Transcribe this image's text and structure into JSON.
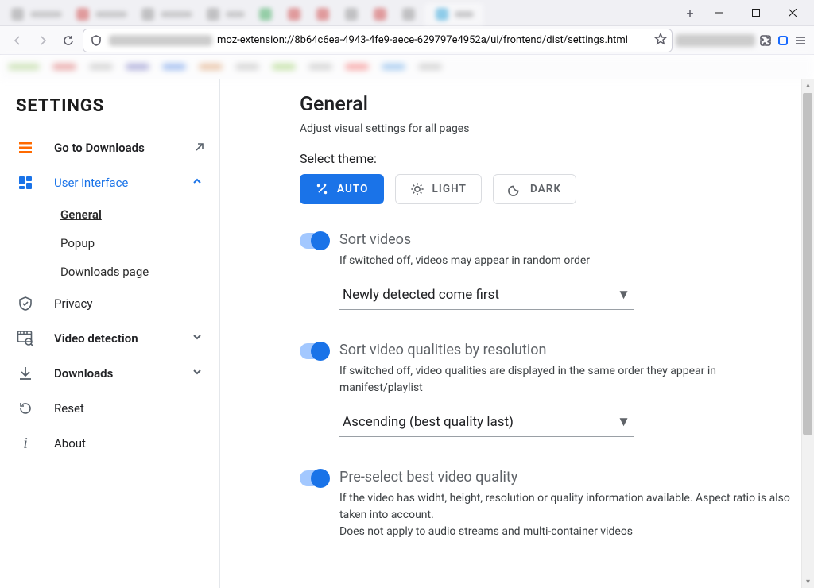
{
  "window": {
    "url": "moz-extension://8b64c6ea-4943-4fe9-aece-629797e4952a/ui/frontend/dist/settings.html"
  },
  "sidebar": {
    "title": "SETTINGS",
    "items": [
      {
        "label": "Go to Downloads"
      },
      {
        "label": "User interface"
      },
      {
        "label": "Privacy"
      },
      {
        "label": "Video detection"
      },
      {
        "label": "Downloads"
      },
      {
        "label": "Reset"
      },
      {
        "label": "About"
      }
    ],
    "ui_sub": [
      {
        "label": "General"
      },
      {
        "label": "Popup"
      },
      {
        "label": "Downloads page"
      }
    ]
  },
  "main": {
    "title": "General",
    "subtitle": "Adjust visual settings for all pages",
    "theme_label": "Select theme:",
    "themes": {
      "auto": "AUTO",
      "light": "LIGHT",
      "dark": "DARK"
    },
    "options": [
      {
        "title": "Sort videos",
        "desc": "If switched off, videos may appear in random order",
        "select_value": "Newly detected come first"
      },
      {
        "title": "Sort video qualities by resolution",
        "desc": "If switched off, video qualities are displayed in the same order they appear in manifest/playlist",
        "select_value": "Ascending (best quality last)"
      },
      {
        "title": "Pre-select best video quality",
        "desc": "If the video has widht, height, resolution or quality information available. Aspect ratio is also taken into account.\nDoes not apply to audio streams and multi-container videos"
      }
    ]
  }
}
